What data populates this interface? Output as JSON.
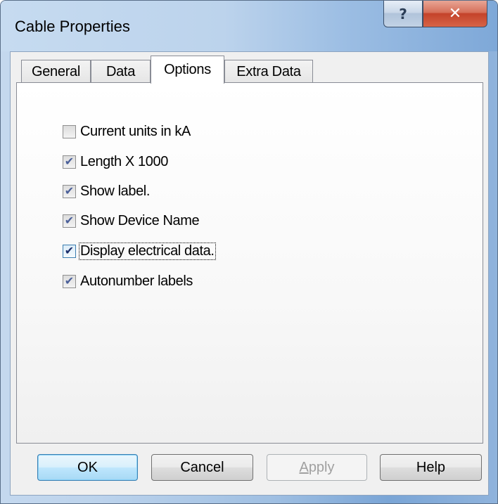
{
  "window": {
    "title": "Cable Properties"
  },
  "caption_buttons": {
    "help_glyph": "?",
    "close_glyph": "✕"
  },
  "tabs": [
    {
      "label": "General",
      "active": false
    },
    {
      "label": "Data",
      "active": false
    },
    {
      "label": "Options",
      "active": true
    },
    {
      "label": "Extra Data",
      "active": false
    }
  ],
  "options": [
    {
      "label": "Current units in kA",
      "checked": false,
      "focused": false
    },
    {
      "label": "Length X 1000",
      "checked": true,
      "focused": false
    },
    {
      "label": "Show label.",
      "checked": true,
      "focused": false
    },
    {
      "label": "Show Device Name",
      "checked": true,
      "focused": false
    },
    {
      "label": "Display electrical data.",
      "checked": true,
      "focused": true
    },
    {
      "label": "Autonumber labels",
      "checked": true,
      "focused": false
    }
  ],
  "buttons": {
    "ok_label": "OK",
    "cancel_label": "Cancel",
    "apply_mnemonic": "A",
    "apply_rest": "pply",
    "apply_enabled": false,
    "help_label": "Help"
  },
  "check_glyph": "✔",
  "colors": {
    "close_button": "#c4432a",
    "default_button_border": "#3c7fb1",
    "check_mark": "#4a5f99"
  }
}
